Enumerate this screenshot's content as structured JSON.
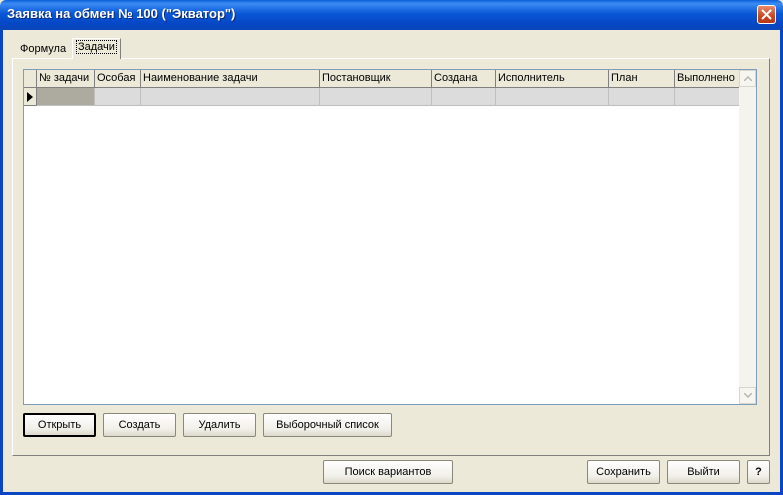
{
  "window": {
    "title": "Заявка на обмен № 100 (\"Экватор\")"
  },
  "tabs": [
    {
      "label": "Формула"
    },
    {
      "label": "Задачи"
    }
  ],
  "grid": {
    "columns": [
      "№ задачи",
      "Особая",
      "Наименование задачи",
      "Постановщик",
      "Создана",
      "Исполнитель",
      "План",
      "Выполнено"
    ],
    "rows": [
      [
        "",
        "",
        "",
        "",
        "",
        "",
        "",
        ""
      ]
    ]
  },
  "actions": {
    "open": "Открыть",
    "create": "Создать",
    "delete": "Удалить",
    "selective_list": "Выборочный список"
  },
  "footer": {
    "search_variants": "Поиск вариантов",
    "save": "Сохранить",
    "exit": "Выйти",
    "help": "?"
  }
}
